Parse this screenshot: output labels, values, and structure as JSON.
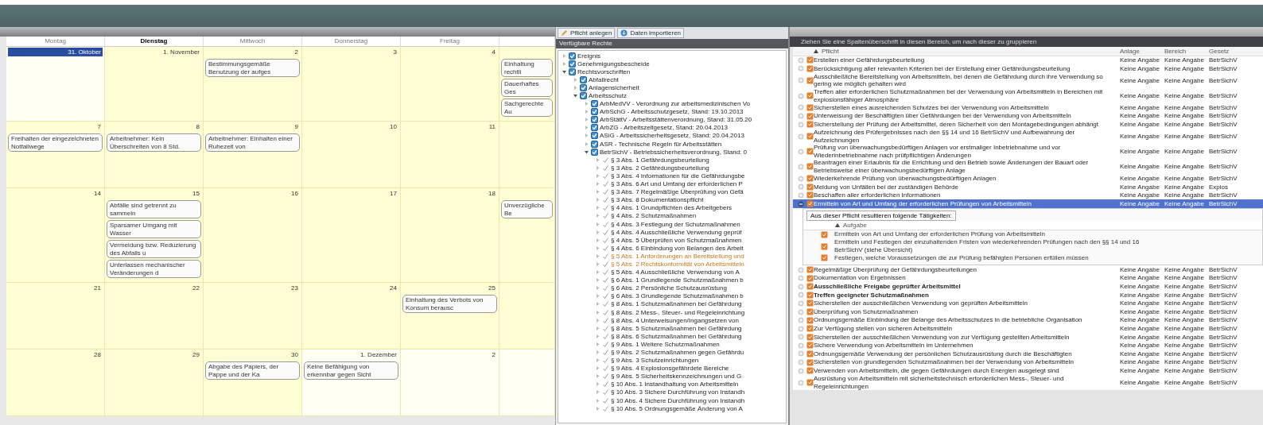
{
  "calendar": {
    "weekdays": [
      {
        "label": "Montag",
        "selected": false
      },
      {
        "label": "Dienstag",
        "selected": true
      },
      {
        "label": "Mittwoch",
        "selected": false
      },
      {
        "label": "Donnerstag",
        "selected": false
      },
      {
        "label": "Freitag",
        "selected": false
      }
    ],
    "weeks": [
      {
        "days": [
          {
            "date": "31. Oktober",
            "other_month": true,
            "selected": true
          },
          {
            "date": "1. November",
            "other_month": false,
            "selected": false
          },
          {
            "date": "2",
            "other_month": false,
            "selected": false,
            "events": [
              "Bestimmungsgemäße Benutzung der aufges"
            ]
          },
          {
            "date": "3",
            "other_month": false,
            "selected": false
          },
          {
            "date": "4",
            "other_month": false,
            "selected": false
          },
          {
            "other_month": false,
            "selected": false,
            "events": [
              "Einhaltung rechtli",
              "Dauerhaftes Ges",
              "Sachgerechte Au"
            ]
          }
        ]
      },
      {
        "days": [
          {
            "date": "7",
            "other_month": false,
            "selected": false,
            "events": [
              "Freihalten der eingezeichneten Notfallwege"
            ]
          },
          {
            "date": "8",
            "other_month": false,
            "selected": false,
            "events": [
              "Arbeitnehmer: Kein Überschreiten von 8 Std."
            ]
          },
          {
            "date": "9",
            "other_month": false,
            "selected": false,
            "events": [
              "Arbeitnehmer: Einhalten einer Ruhezeit von"
            ]
          },
          {
            "date": "10",
            "other_month": false,
            "selected": false
          },
          {
            "date": "11",
            "other_month": false,
            "selected": false
          },
          {
            "other_month": false,
            "selected": false
          }
        ]
      },
      {
        "days": [
          {
            "date": "14",
            "other_month": false,
            "selected": false
          },
          {
            "date": "15",
            "other_month": false,
            "selected": false,
            "events": [
              "Abfälle sind getrennt zu sammeln",
              "Sparsamer Umgang mit Wasser",
              "Vermeidung bzw. Reduzierung des Abfalls u",
              "Unterlassen mechanischer Veränderungen d"
            ]
          },
          {
            "date": "16",
            "other_month": false,
            "selected": false
          },
          {
            "date": "17",
            "other_month": false,
            "selected": false
          },
          {
            "date": "18",
            "other_month": false,
            "selected": false
          },
          {
            "other_month": false,
            "selected": false,
            "events": [
              "Unverzügliche Be"
            ]
          }
        ]
      },
      {
        "days": [
          {
            "date": "21",
            "other_month": false,
            "selected": false
          },
          {
            "date": "22",
            "other_month": false,
            "selected": false
          },
          {
            "date": "23",
            "other_month": false,
            "selected": false
          },
          {
            "date": "24",
            "other_month": false,
            "selected": false
          },
          {
            "date": "25",
            "other_month": false,
            "selected": false,
            "events": [
              "Einhaltung des Verbots von Konsum berausc"
            ]
          },
          {
            "other_month": false,
            "selected": false
          }
        ]
      },
      {
        "days": [
          {
            "date": "28",
            "other_month": false,
            "selected": false
          },
          {
            "date": "29",
            "other_month": false,
            "selected": false
          },
          {
            "date": "30",
            "other_month": false,
            "selected": false,
            "events": [
              "Abgabe des Papiers, der Pappe und der Ka"
            ]
          },
          {
            "date": "1. Dezember",
            "other_month": true,
            "selected": false,
            "events": [
              "Keine Befähigung von erkennbar gegen Sicht"
            ]
          },
          {
            "date": "2",
            "other_month": true,
            "selected": false
          },
          {
            "other_month": true,
            "selected": false
          }
        ]
      }
    ]
  },
  "toolbar": {
    "buttons": [
      "Pflicht anlegen",
      "Daten importieren"
    ]
  },
  "tree": {
    "title": "Verfügbare Rechte",
    "items": [
      {
        "label": "Ereignis",
        "kind": "group",
        "expanded": false
      },
      {
        "label": "Genehmigungsbescheide",
        "kind": "group",
        "expanded": false
      },
      {
        "label": "Rechtsvorschriften",
        "kind": "group",
        "expanded": true,
        "children": [
          {
            "label": "Abfallrecht",
            "kind": "group",
            "expanded": false
          },
          {
            "label": "Anlagensicherheit",
            "kind": "group",
            "expanded": false
          },
          {
            "label": "Arbeitsschutz",
            "kind": "group",
            "expanded": true,
            "children": [
              {
                "label": "ArbMedVV - Verordnung zur arbeitsmedizinischen Vo",
                "kind": "group",
                "expanded": false
              },
              {
                "label": "ArbSchG - Arbeitsschutzgesetz, Stand: 19.10.2013",
                "kind": "group",
                "expanded": false
              },
              {
                "label": "ArbStättV - Arbeitsstättenverordnung, Stand: 31.05.20",
                "kind": "group",
                "expanded": false
              },
              {
                "label": "ArbZG - Arbeitszeitgesetz, Stand: 20.04.2013",
                "kind": "group",
                "expanded": false
              },
              {
                "label": "ASiG - Arbeitssicherheitsgesetz, Stand: 20.04.2013",
                "kind": "group",
                "expanded": false
              },
              {
                "label": "ASR - Technische Regeln für Arbeitsstätten",
                "kind": "group",
                "expanded": false
              },
              {
                "label": "BetrSichV - Betriebssicherheitsverordnung, Stand: 0",
                "kind": "group",
                "expanded": true,
                "children": [
                  {
                    "label": "§ 3 Abs. 1 Gefährdungsbeurteilung",
                    "kind": "paragraph",
                    "highlighted": false,
                    "expanded": false
                  },
                  {
                    "label": "§ 3 Abs. 2 Gefährdungsbeurteilung",
                    "kind": "paragraph",
                    "highlighted": false,
                    "expanded": false
                  },
                  {
                    "label": "§ 3 Abs. 4 Informationen für die Gefährdungsbe",
                    "kind": "paragraph",
                    "highlighted": false,
                    "expanded": false
                  },
                  {
                    "label": "§ 3 Abs. 6 Art und Umfang der erforderlichen P",
                    "kind": "paragraph",
                    "highlighted": false,
                    "expanded": false
                  },
                  {
                    "label": "§ 3 Abs. 7 Regelmäßige Überprüfung von Gefä",
                    "kind": "paragraph",
                    "highlighted": false,
                    "expanded": false
                  },
                  {
                    "label": "§ 3 Abs. 8 Dokumentationspflicht",
                    "kind": "paragraph",
                    "highlighted": false,
                    "expanded": false
                  },
                  {
                    "label": "§ 4 Abs. 1 Grundpflichten des Arbeitgebers",
                    "kind": "paragraph",
                    "highlighted": false,
                    "expanded": false
                  },
                  {
                    "label": "§ 4 Abs. 2 Schutzmaßnahmen",
                    "kind": "paragraph",
                    "highlighted": false,
                    "expanded": false
                  },
                  {
                    "label": "§ 4 Abs. 3 Festlegung der Schutzmaßnahmen",
                    "kind": "paragraph",
                    "highlighted": false,
                    "expanded": false
                  },
                  {
                    "label": "§ 4 Abs. 4 Ausschließliche Verwendung geprüf",
                    "kind": "paragraph",
                    "highlighted": false,
                    "expanded": false
                  },
                  {
                    "label": "§ 4 Abs. 5 Überprüfen von Schutzmaßnahmen",
                    "kind": "paragraph",
                    "highlighted": false,
                    "expanded": false
                  },
                  {
                    "label": "§ 4 Abs. 6 Einbindung von Belangen des Arbeit",
                    "kind": "paragraph",
                    "highlighted": false,
                    "expanded": false
                  },
                  {
                    "label": "§ 5 Abs. 1 Anforderungen an Bereitstellung und",
                    "kind": "paragraph",
                    "highlighted": true,
                    "expanded": false
                  },
                  {
                    "label": "§ 5 Abs. 2 Rechtskonformität von Arbeitsmitteln",
                    "kind": "paragraph",
                    "highlighted": true,
                    "expanded": false
                  },
                  {
                    "label": "§ 5 Abs. 4 Ausschließliche Verwendung von A",
                    "kind": "paragraph",
                    "highlighted": false,
                    "expanded": false
                  },
                  {
                    "label": "§ 6 Abs. 1 Grundlegende Schutzmaßnahmen b",
                    "kind": "paragraph",
                    "highlighted": false,
                    "expanded": false
                  },
                  {
                    "label": "§ 6 Abs. 2 Persönliche Schutzausrüstung",
                    "kind": "paragraph",
                    "highlighted": false,
                    "expanded": false
                  },
                  {
                    "label": "§ 6 Abs. 3 Grundlegende Schutzmaßnahmen b",
                    "kind": "paragraph",
                    "highlighted": false,
                    "expanded": false
                  },
                  {
                    "label": "§ 8 Abs. 1 Schutzmaßnahmen bei Gefährdung",
                    "kind": "paragraph",
                    "highlighted": false,
                    "expanded": false
                  },
                  {
                    "label": "§ 8 Abs. 2 Mess-, Steuer- und Regeleinrichtung",
                    "kind": "paragraph",
                    "highlighted": false,
                    "expanded": false
                  },
                  {
                    "label": "§ 8 Abs. 4 Unterweisungen/Ingangsetzen von",
                    "kind": "paragraph",
                    "highlighted": false,
                    "expanded": false
                  },
                  {
                    "label": "§ 8 Abs. 5 Schutzmaßnahmen bei Gefährdung",
                    "kind": "paragraph",
                    "highlighted": false,
                    "expanded": false
                  },
                  {
                    "label": "§ 8 Abs. 6 Schutzmaßnahmen bei Gefährdung",
                    "kind": "paragraph",
                    "highlighted": false,
                    "expanded": false
                  },
                  {
                    "label": "§ 9 Abs. 1 Weitere Schutzmaßnahmen",
                    "kind": "paragraph",
                    "highlighted": false,
                    "expanded": false
                  },
                  {
                    "label": "§ 9 Abs. 2 Schutzmaßnahmen gegen Gefährdu",
                    "kind": "paragraph",
                    "highlighted": false,
                    "expanded": false
                  },
                  {
                    "label": "§ 9 Abs. 3 Schutzeinrichtungen",
                    "kind": "paragraph",
                    "highlighted": false,
                    "expanded": false
                  },
                  {
                    "label": "§ 9 Abs. 4 Explosionsgefährdete Bereiche",
                    "kind": "paragraph",
                    "highlighted": false,
                    "expanded": false
                  },
                  {
                    "label": "§ 9 Abs. 5 Sicherheitskennzeichnungen und G",
                    "kind": "paragraph",
                    "highlighted": false,
                    "expanded": false
                  },
                  {
                    "label": "§ 10 Abs. 1 Instandhaltung von Arbeitsmitteln",
                    "kind": "paragraph",
                    "highlighted": false,
                    "expanded": false
                  },
                  {
                    "label": "§ 10 Abs. 3 Sichere Durchführung von Instandh",
                    "kind": "paragraph",
                    "highlighted": false,
                    "expanded": false
                  },
                  {
                    "label": "§ 10 Abs. 4 Sichere Durchführung von Instandh",
                    "kind": "paragraph",
                    "highlighted": false,
                    "expanded": false
                  },
                  {
                    "label": "§ 10 Abs. 5 Ordnungsgemäße Änderung von A",
                    "kind": "paragraph",
                    "highlighted": false,
                    "expanded": false
                  }
                ]
              }
            ]
          }
        ]
      }
    ]
  },
  "grid": {
    "group_panel": "Ziehen Sie eine Spaltenüberschrift in diesen Bereich, um nach dieser zu gruppieren",
    "columns": [
      "Pflicht",
      "Anlage",
      "Bereich",
      "Gesetz"
    ],
    "rows": [
      {
        "pflicht": "Erstellen einer Gefährdungsbeurteilung",
        "anlage": "Keine Angabe",
        "bereich": "Keine Angabe",
        "gesetz": "BetrSichV",
        "selected": false,
        "expanded": false,
        "bold": false
      },
      {
        "pflicht": "Berücksichtigung aller relevanten Kriterien bei der Erstellung einer Gefährdungsbeurteilung",
        "anlage": "Keine Angabe",
        "bereich": "Keine Angabe",
        "gesetz": "BetrSichV",
        "selected": false,
        "expanded": false,
        "bold": false
      },
      {
        "pflicht": "Ausschließliche Bereitstellung von Arbeitsmitteln, bei denen die Gefährdung durch ihre Verwendung so gering wie möglich gehalten wird",
        "anlage": "Keine Angabe",
        "bereich": "Keine Angabe",
        "gesetz": "BetrSichV",
        "selected": false,
        "expanded": false,
        "bold": false
      },
      {
        "pflicht": "Treffen aller erforderlichen Schutzmaßnahmen bei der Verwendung von Arbeitsmitteln in Bereichen mit explosionsfähiger Atmosphäre",
        "anlage": "Keine Angabe",
        "bereich": "Keine Angabe",
        "gesetz": "BetrSichV",
        "selected": false,
        "expanded": false,
        "bold": false
      },
      {
        "pflicht": "Sicherstellen eines ausreichenden Schutzes bei der Verwendung von Arbeitsmitteln",
        "anlage": "Keine Angabe",
        "bereich": "Keine Angabe",
        "gesetz": "BetrSichV",
        "selected": false,
        "expanded": false,
        "bold": false
      },
      {
        "pflicht": "Unterweisung der Beschäftigten über Gefährdungen bei der Verwendung von Arbeitsmitteln",
        "anlage": "Keine Angabe",
        "bereich": "Keine Angabe",
        "gesetz": "BetrSichV",
        "selected": false,
        "expanded": false,
        "bold": false
      },
      {
        "pflicht": "Sicherstellung der Prüfung der Arbeitsmittel, deren Sicherheit von den Montagebedingungen abhängt",
        "anlage": "Keine Angabe",
        "bereich": "Keine Angabe",
        "gesetz": "BetrSichV",
        "selected": false,
        "expanded": false,
        "bold": false
      },
      {
        "pflicht": "Aufzeichnung des Prüfergebnisses nach den §§ 14 und 16 BetrSichV und Aufbewahrung der Aufzeichnungen",
        "anlage": "Keine Angabe",
        "bereich": "Keine Angabe",
        "gesetz": "BetrSichV",
        "selected": false,
        "expanded": false,
        "bold": false
      },
      {
        "pflicht": "Prüfung von überwachungsbedürftigen Anlagen vor erstmaliger Inbetriebnahme und vor Wiederinbetriebnahme nach prüfpflichtigen Änderungen",
        "anlage": "Keine Angabe",
        "bereich": "Keine Angabe",
        "gesetz": "BetrSichV",
        "selected": false,
        "expanded": false,
        "bold": false
      },
      {
        "pflicht": "Beantragen einer Erlaubnis für die Errichtung und den Betrieb sowie Änderungen der Bauart oder Betriebsweise einer überwachungsbedürftigen Anlage",
        "anlage": "Keine Angabe",
        "bereich": "Keine Angabe",
        "gesetz": "BetrSichV",
        "selected": false,
        "expanded": false,
        "bold": false
      },
      {
        "pflicht": "Wiederkehrende Prüfung von überwachungsbedürftigen Anlagen",
        "anlage": "Keine Angabe",
        "bereich": "Keine Angabe",
        "gesetz": "BetrSichV",
        "selected": false,
        "expanded": false,
        "bold": false
      },
      {
        "pflicht": "Meldung von Unfällen bei der zuständigen Behörde",
        "anlage": "Keine Angabe",
        "bereich": "Keine Angabe",
        "gesetz": "Explos",
        "selected": false,
        "expanded": false,
        "bold": false
      },
      {
        "pflicht": "Beschaffen aller erforderlichen Informationen",
        "anlage": "Keine Angabe",
        "bereich": "Keine Angabe",
        "gesetz": "BetrSichV",
        "selected": false,
        "expanded": false,
        "bold": false
      },
      {
        "pflicht": "Ermitteln von Art und Umfang der erforderlichen Prüfungen von Arbeitsmitteln",
        "anlage": "Keine Angabe",
        "bereich": "Keine Angabe",
        "gesetz": "BetrSichV",
        "selected": true,
        "expanded": true,
        "bold": false,
        "detail": {
          "tab": "Aus dieser Pflicht resultieren folgende Tätigkeiten:",
          "column": "Aufgabe",
          "tasks": [
            "Ermitteln von Art und Umfang der erforderlichen Prüfung von Arbeitsmitteln",
            "Ermitteln und Festlegen der einzuhaltenden Fristen von wiederkehrenden Prüfungen nach den §§ 14 und 16 BetrSichV (siehe Übersicht)",
            "Festlegen, welche Voraussetzungen die zur Prüfung befähigten Personen erfüllen müssen"
          ]
        }
      },
      {
        "pflicht": "Regelmäßige Überprüfung der Gefährdungsbeurteilungen",
        "anlage": "Keine Angabe",
        "bereich": "Keine Angabe",
        "gesetz": "BetrSichV",
        "selected": false,
        "expanded": false,
        "bold": false
      },
      {
        "pflicht": "Dokumentation von Ergebnissen",
        "anlage": "Keine Angabe",
        "bereich": "Keine Angabe",
        "gesetz": "BetrSichV",
        "selected": false,
        "expanded": false,
        "bold": false
      },
      {
        "pflicht": "Ausschließliche Freigabe geprüfter Arbeitsmittel",
        "anlage": "Keine Angabe",
        "bereich": "Keine Angabe",
        "gesetz": "BetrSichV",
        "selected": false,
        "expanded": false,
        "bold": true
      },
      {
        "pflicht": "Treffen geeigneter Schutzmaßnahmen",
        "anlage": "Keine Angabe",
        "bereich": "Keine Angabe",
        "gesetz": "BetrSichV",
        "selected": false,
        "expanded": false,
        "bold": true
      },
      {
        "pflicht": "Sicherstellen der ausschließlichen Verwendung von geprüften Arbeitsmitteln",
        "anlage": "Keine Angabe",
        "bereich": "Keine Angabe",
        "gesetz": "BetrSichV",
        "selected": false,
        "expanded": false,
        "bold": false
      },
      {
        "pflicht": "Überprüfung von Schutzmaßnahmen",
        "anlage": "Keine Angabe",
        "bereich": "Keine Angabe",
        "gesetz": "BetrSichV",
        "selected": false,
        "expanded": false,
        "bold": false
      },
      {
        "pflicht": "Ordnungsgemäße Einbindung der Belange des Arbeitsschutzes in die betriebliche Organisation",
        "anlage": "Keine Angabe",
        "bereich": "Keine Angabe",
        "gesetz": "BetrSichV",
        "selected": false,
        "expanded": false,
        "bold": false
      },
      {
        "pflicht": "Zur Verfügung stellen von sicheren Arbeitsmitteln",
        "anlage": "Keine Angabe",
        "bereich": "Keine Angabe",
        "gesetz": "BetrSichV",
        "selected": false,
        "expanded": false,
        "bold": false
      },
      {
        "pflicht": "Sicherstellen der ausschließlichen Verwendung von zur Verfügung gestellten Arbeitsmitteln",
        "anlage": "Keine Angabe",
        "bereich": "Keine Angabe",
        "gesetz": "BetrSichV",
        "selected": false,
        "expanded": false,
        "bold": false
      },
      {
        "pflicht": "Sichere Verwendung von Arbeitsmitteln im Unternehmen",
        "anlage": "Keine Angabe",
        "bereich": "Keine Angabe",
        "gesetz": "BetrSichV",
        "selected": false,
        "expanded": false,
        "bold": false
      },
      {
        "pflicht": "Ordnungsgemäße Verwendung der persönlichen Schutzausrüstung durch die Beschäftigten",
        "anlage": "Keine Angabe",
        "bereich": "Keine Angabe",
        "gesetz": "BetrSichV",
        "selected": false,
        "expanded": false,
        "bold": false
      },
      {
        "pflicht": "Sicherstellen von grundlegenden Schutzmaßnahmen bei der Verwendung von Arbeitsmitteln",
        "anlage": "Keine Angabe",
        "bereich": "Keine Angabe",
        "gesetz": "BetrSichV",
        "selected": false,
        "expanded": false,
        "bold": false
      },
      {
        "pflicht": "Verwenden von Arbeitsmitteln, die gegen Gefährdungen durch Energien ausgelegt sind",
        "anlage": "Keine Angabe",
        "bereich": "Keine Angabe",
        "gesetz": "BetrSichV",
        "selected": false,
        "expanded": false,
        "bold": false
      },
      {
        "pflicht": "Ausrüstung von Arbeitsmitteln mit sicherheitstechnisch erforderlichen Mess-, Steuer- und Regeleinrichtungen",
        "anlage": "Keine Angabe",
        "bereich": "Keine Angabe",
        "gesetz": "BetrSichV",
        "selected": false,
        "expanded": false,
        "bold": false
      }
    ]
  }
}
